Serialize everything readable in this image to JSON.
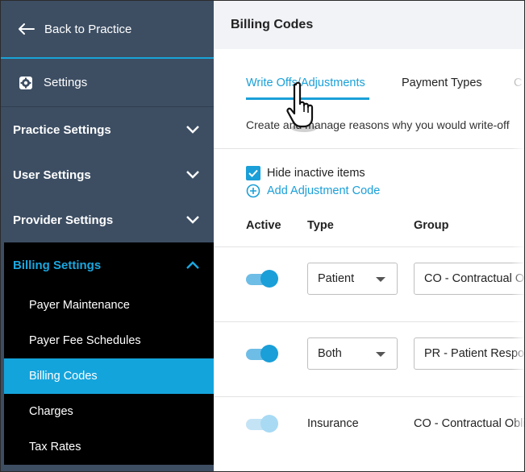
{
  "sidebar": {
    "back_label": "Back to Practice",
    "settings_label": "Settings",
    "sections": [
      {
        "label": "Practice Settings"
      },
      {
        "label": "User Settings"
      },
      {
        "label": "Provider Settings"
      }
    ],
    "billing": {
      "label": "Billing Settings",
      "items": [
        {
          "label": "Payer Maintenance"
        },
        {
          "label": "Payer Fee Schedules"
        },
        {
          "label": "Billing Codes"
        },
        {
          "label": "Charges"
        },
        {
          "label": "Tax Rates"
        }
      ]
    },
    "colors": {
      "bg": "#3d4e63",
      "accent": "#14a4dc",
      "active_group_bg": "#000000"
    }
  },
  "main": {
    "title": "Billing Codes",
    "tabs": [
      {
        "label": "Write Offs/Adjustments"
      },
      {
        "label": "Payment Types"
      },
      {
        "label": "C"
      }
    ],
    "description": "Create and manage reasons why you would write-off",
    "hide_inactive_label": "Hide inactive items",
    "add_label": "Add Adjustment Code",
    "columns": {
      "active": "Active",
      "type": "Type",
      "group": "Group"
    },
    "rows": [
      {
        "type": "Patient",
        "group": "CO - Contractual Obligation"
      },
      {
        "type": "Both",
        "group": "PR - Patient Responsibility"
      },
      {
        "type": "Insurance",
        "group": "CO - Contractual Obligation"
      }
    ]
  },
  "icons": [
    "back-arrow-icon",
    "gear-icon",
    "chevron-down-icon",
    "chevron-up-icon",
    "checkbox-checked-icon",
    "plus-circle-icon",
    "hand-cursor-icon"
  ]
}
